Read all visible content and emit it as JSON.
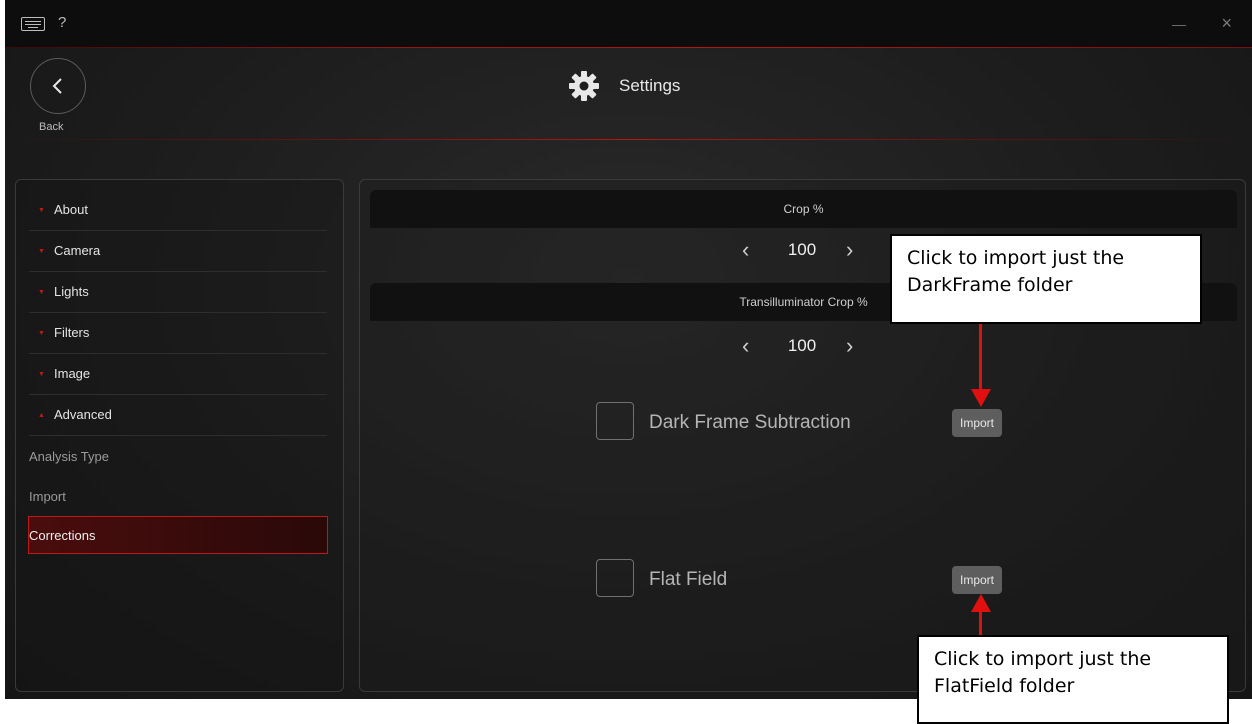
{
  "titlebar": {
    "help_label": "?",
    "close_glyph": "×"
  },
  "header": {
    "back_label": "Back",
    "title": "Settings"
  },
  "sidebar": {
    "items": [
      {
        "label": "About",
        "expanded": false
      },
      {
        "label": "Camera",
        "expanded": false
      },
      {
        "label": "Lights",
        "expanded": false
      },
      {
        "label": "Filters",
        "expanded": false
      },
      {
        "label": "Image",
        "expanded": false
      },
      {
        "label": "Advanced",
        "expanded": true
      }
    ],
    "subitems": [
      {
        "label": "Analysis Type",
        "active": false
      },
      {
        "label": "Import",
        "active": false
      },
      {
        "label": "Corrections",
        "active": true
      }
    ]
  },
  "content": {
    "crop": {
      "title": "Crop %",
      "value": "100",
      "dec": "‹",
      "inc": "›"
    },
    "trans_crop": {
      "title": "Transilluminator Crop %",
      "value": "100",
      "dec": "‹",
      "inc": "›"
    },
    "dark_frame": {
      "label": "Dark Frame Subtraction",
      "checked": false,
      "button": "Import"
    },
    "flat_field": {
      "label": "Flat Field",
      "checked": false,
      "button": "Import"
    }
  },
  "callouts": {
    "dark": {
      "line1": "Click to import just the",
      "line2": "DarkFrame folder"
    },
    "flat": {
      "line1": "Click to import just the",
      "line2": "FlatField folder"
    }
  },
  "colors": {
    "accent": "#c01818",
    "background": "#1d1d1d",
    "arrow": "#e01010"
  },
  "icons": {
    "keyboard": "keyboard-icon",
    "help": "help-icon",
    "back": "chevron-left-icon",
    "settings": "gear-icon"
  }
}
